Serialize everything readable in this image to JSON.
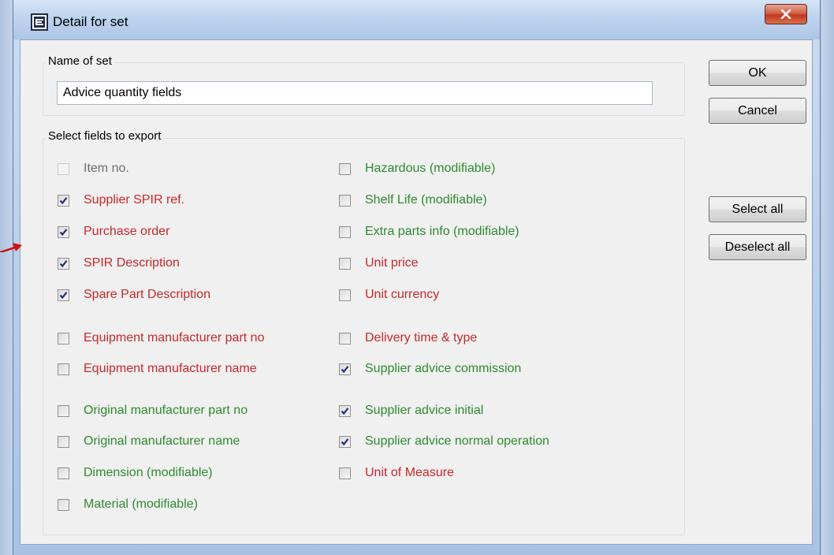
{
  "window": {
    "title": "Detail for set",
    "close_glyph": "X"
  },
  "name_group": {
    "label": "Name of set",
    "value": "Advice quantity fields"
  },
  "buttons": {
    "ok": "OK",
    "cancel": "Cancel",
    "select_all": "Select all",
    "deselect_all": "Deselect all"
  },
  "fields_group": {
    "label": "Select fields to export"
  },
  "colors": {
    "mandatory": "#c8282a",
    "modifiable": "#2e8b2e",
    "disabled": "#6d6d6d"
  },
  "fields_left": [
    {
      "label": "Item no.",
      "checked": false,
      "color": "gray",
      "disabled": true
    },
    {
      "label": "Supplier SPIR ref.",
      "checked": true,
      "color": "red"
    },
    {
      "label": "Purchase order",
      "checked": true,
      "color": "red"
    },
    {
      "label": "SPIR Description",
      "checked": true,
      "color": "red"
    },
    {
      "label": "Spare Part Description",
      "checked": true,
      "color": "red"
    },
    {
      "label": "Equipment manufacturer part no",
      "checked": false,
      "color": "red"
    },
    {
      "label": "Equipment manufacturer name",
      "checked": false,
      "color": "red"
    },
    {
      "label": "Original manufacturer part no",
      "checked": false,
      "color": "green"
    },
    {
      "label": "Original manufacturer name",
      "checked": false,
      "color": "green"
    },
    {
      "label": "Dimension (modifiable)",
      "checked": false,
      "color": "green"
    },
    {
      "label": "Material (modifiable)",
      "checked": false,
      "color": "green"
    }
  ],
  "fields_right": [
    {
      "label": "Hazardous (modifiable)",
      "checked": false,
      "color": "green"
    },
    {
      "label": "Shelf Life (modifiable)",
      "checked": false,
      "color": "green"
    },
    {
      "label": "Extra parts info (modifiable)",
      "checked": false,
      "color": "green"
    },
    {
      "label": "Unit price",
      "checked": false,
      "color": "red"
    },
    {
      "label": "Unit currency",
      "checked": false,
      "color": "red"
    },
    {
      "label": "Delivery time & type",
      "checked": false,
      "color": "red"
    },
    {
      "label": "Supplier advice commission",
      "checked": true,
      "color": "green"
    },
    {
      "label": "Supplier advice initial",
      "checked": true,
      "color": "green"
    },
    {
      "label": "Supplier advice normal operation",
      "checked": true,
      "color": "green"
    },
    {
      "label": "Unit of Measure",
      "checked": false,
      "color": "red"
    }
  ]
}
